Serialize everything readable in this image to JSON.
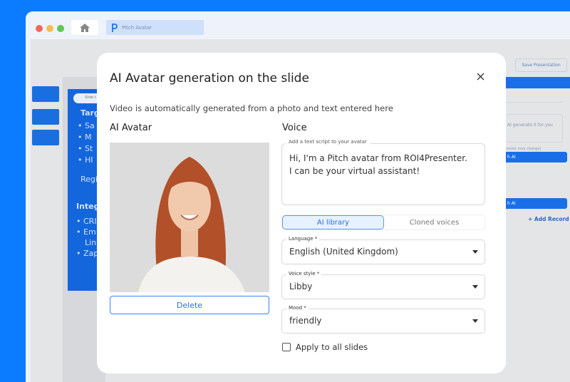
{
  "browser": {
    "tab_title": "Pitch Avatar",
    "home_icon": "home-icon",
    "traffic_colors": [
      "#ee6a5f",
      "#f5be4f",
      "#62c554"
    ]
  },
  "background_app": {
    "save_button": "Save Presentation",
    "slide": {
      "checkbox_label": "Slide t",
      "heading1": "Targ",
      "bullets1": [
        "Sa",
        "M",
        "St",
        "HI"
      ],
      "region": "Regi",
      "heading2": "Integ",
      "bullets2": [
        "CRI",
        "Em",
        "Lin",
        "Zap"
      ]
    },
    "right_panel": {
      "placeholder": "AI generate it for you",
      "note": "racter may change)",
      "ai_button1": "h AI",
      "ai_button2": "h AI",
      "add_record": "+ Add Record"
    }
  },
  "modal": {
    "title": "AI Avatar generation on the slide",
    "subtitle": "Video is automatically generated from a photo and text entered here",
    "avatar_heading": "AI Avatar",
    "delete_button": "Delete",
    "voice_heading": "Voice",
    "script_label": "Add a text script to your avatar",
    "script_lines": [
      "Hi, I'm a Pitch avatar from ROI4Presenter.",
      "I can be your virtual assistant!"
    ],
    "voice_tabs": [
      {
        "label": "AI library",
        "active": true
      },
      {
        "label": "Cloned voices",
        "active": false
      }
    ],
    "language": {
      "label": "Language *",
      "value": "English (United Kingdom)"
    },
    "voice_style": {
      "label": "Voice style *",
      "value": "Libby"
    },
    "mood": {
      "label": "Mood *",
      "value": "friendly"
    },
    "apply_all": {
      "label": "Apply to all slides",
      "checked": false
    }
  }
}
